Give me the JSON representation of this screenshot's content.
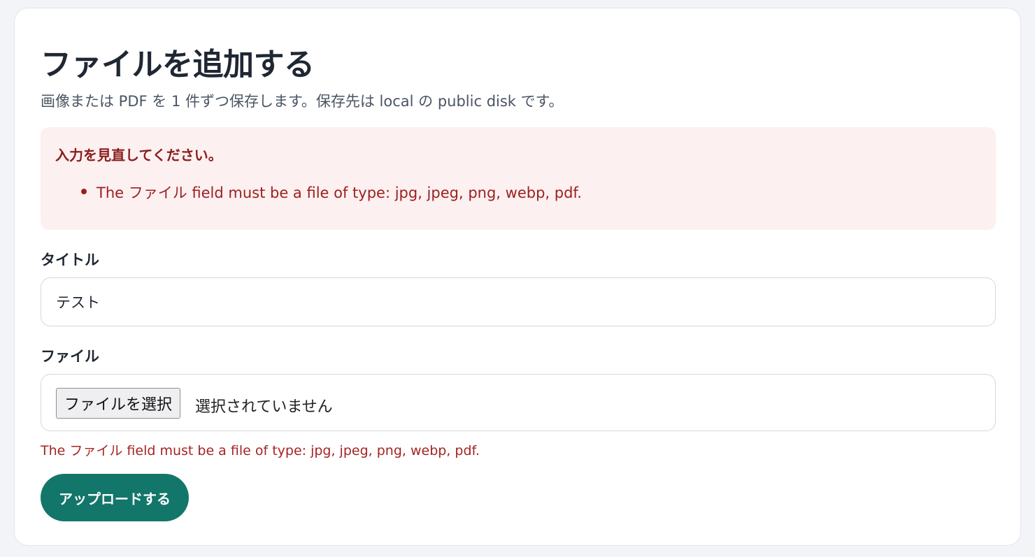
{
  "page": {
    "title": "ファイルを追加する",
    "subtitle": "画像または PDF を 1 件ずつ保存します。保存先は local の public disk です。"
  },
  "errors": {
    "heading": "入力を見直してください。",
    "items": [
      "The ファイル field must be a file of type: jpg, jpeg, png, webp, pdf."
    ]
  },
  "form": {
    "title_label": "タイトル",
    "title_value": "テスト",
    "file_label": "ファイル",
    "file_button_label": "ファイルを選択",
    "file_status": "選択されていません",
    "file_error": "The ファイル field must be a file of type: jpg, jpeg, png, webp, pdf.",
    "submit_label": "アップロードする"
  },
  "colors": {
    "accent": "#13766a",
    "error_text": "#9b1f1f",
    "error_background": "#fdf0f0"
  }
}
